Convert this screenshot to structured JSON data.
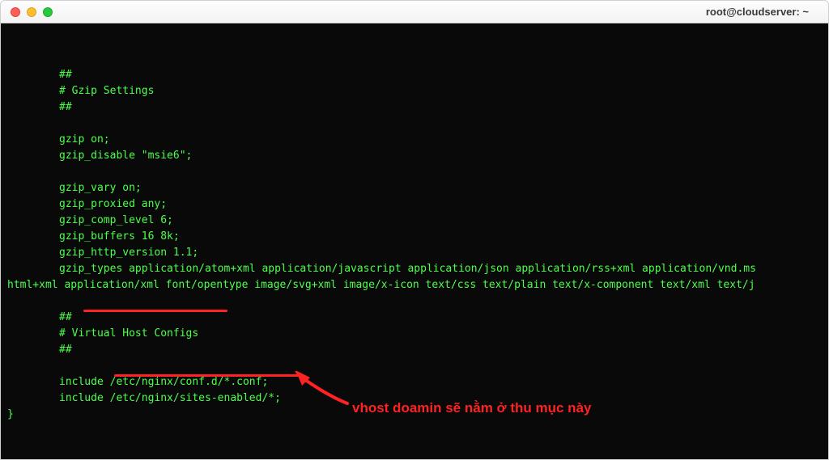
{
  "window": {
    "title": "root@cloudserver: ~"
  },
  "terminal": {
    "lines": [
      {
        "text": "##",
        "indent": true
      },
      {
        "text": "# Gzip Settings",
        "indent": true
      },
      {
        "text": "##",
        "indent": true
      },
      {
        "text": "",
        "indent": true
      },
      {
        "text": "gzip on;",
        "indent": true
      },
      {
        "text": "gzip_disable \"msie6\";",
        "indent": true
      },
      {
        "text": "",
        "indent": true
      },
      {
        "text": "gzip_vary on;",
        "indent": true
      },
      {
        "text": "gzip_proxied any;",
        "indent": true
      },
      {
        "text": "gzip_comp_level 6;",
        "indent": true
      },
      {
        "text": "gzip_buffers 16 8k;",
        "indent": true
      },
      {
        "text": "gzip_http_version 1.1;",
        "indent": true
      },
      {
        "text": "gzip_types application/atom+xml application/javascript application/json application/rss+xml application/vnd.ms",
        "indent": true
      },
      {
        "text": "html+xml application/xml font/opentype image/svg+xml image/x-icon text/css text/plain text/x-component text/xml text/j",
        "indent": false
      },
      {
        "text": "",
        "indent": true
      },
      {
        "text": "##",
        "indent": true
      },
      {
        "text": "# Virtual Host Configs",
        "indent": true
      },
      {
        "text": "##",
        "indent": true
      },
      {
        "text": "",
        "indent": true
      },
      {
        "text": "include /etc/nginx/conf.d/*.conf;",
        "indent": true
      },
      {
        "text": "include /etc/nginx/sites-enabled/*;",
        "indent": true
      },
      {
        "text": "}",
        "indent": false
      }
    ]
  },
  "annotation": {
    "text": "vhost doamin sẽ nằm ở thu mục này"
  }
}
